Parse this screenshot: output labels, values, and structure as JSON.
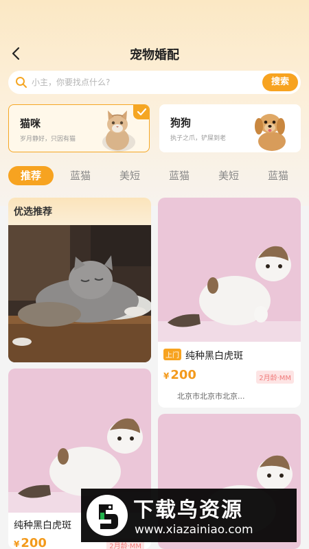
{
  "nav": {
    "title": "宠物婚配"
  },
  "search": {
    "placeholder": "小主，你要找点什么?",
    "button": "搜索"
  },
  "types": [
    {
      "name": "猫咪",
      "subtitle": "岁月静好，只因有猫",
      "selected": true
    },
    {
      "name": "狗狗",
      "subtitle": "执子之爪，铲屎到老",
      "selected": false
    }
  ],
  "tabs": [
    "推荐",
    "蓝猫",
    "美短",
    "蓝猫",
    "美短",
    "蓝猫"
  ],
  "recommend": {
    "title": "优选推荐"
  },
  "pets": [
    {
      "tag": "上门",
      "title": "纯种黑白虎斑",
      "currency": "¥",
      "price": "200",
      "age": "2月龄·MM",
      "location": "北京市北京市北京..."
    },
    {
      "title": "纯种黑白虎斑",
      "currency": "¥",
      "price": "200",
      "age": "2月龄·MM"
    }
  ],
  "watermark": {
    "text": "下载鸟资源",
    "url": "www.xiazainiao.com"
  },
  "colors": {
    "accent": "#f7a320",
    "price": "#f39a1c",
    "age_tag": "#f07a7a"
  }
}
